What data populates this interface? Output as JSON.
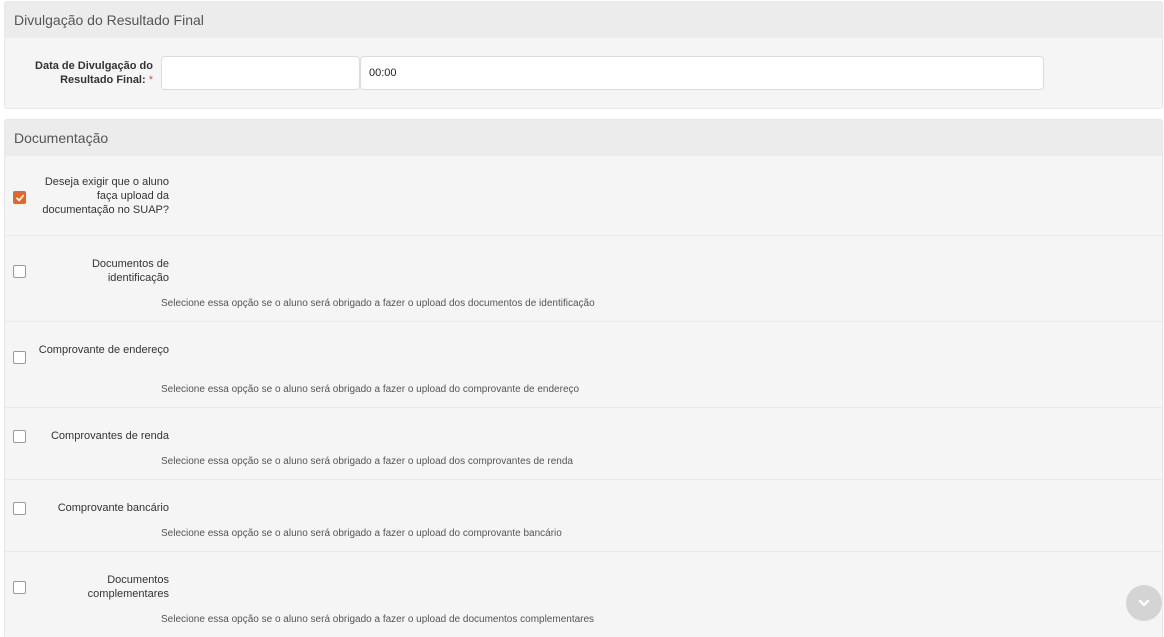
{
  "result_section": {
    "title": "Divulgação do Resultado Final",
    "date_label": "Data de Divulgação do Resultado Final:",
    "required_mark": "*",
    "date_value": "",
    "time_value": "00:00"
  },
  "docs_section": {
    "title": "Documentação",
    "require_upload": {
      "label": "Deseja exigir que o aluno faça upload da documentação no SUAP?",
      "checked": true
    },
    "options": [
      {
        "label": "Documentos de identificação",
        "help": "Selecione essa opção se o aluno será obrigado a fazer o upload dos documentos de identificação",
        "checked": false
      },
      {
        "label": "Comprovante de endereço",
        "help": "Selecione essa opção se o aluno será obrigado a fazer o upload do comprovante de endereço",
        "checked": false
      },
      {
        "label": "Comprovantes de renda",
        "help": "Selecione essa opção se o aluno será obrigado a fazer o upload dos comprovantes de renda",
        "checked": false
      },
      {
        "label": "Comprovante bancário",
        "help": "Selecione essa opção se o aluno será obrigado a fazer o upload do comprovante bancário",
        "checked": false
      },
      {
        "label": "Documentos complementares",
        "help": "Selecione essa opção se o aluno será obrigado a fazer o upload de documentos complementares",
        "checked": false
      }
    ]
  },
  "colors": {
    "accent": "#e86426",
    "required": "#e74c3c"
  },
  "icons": {
    "checkmark": "check-icon",
    "scroll": "chevron-down-icon"
  }
}
